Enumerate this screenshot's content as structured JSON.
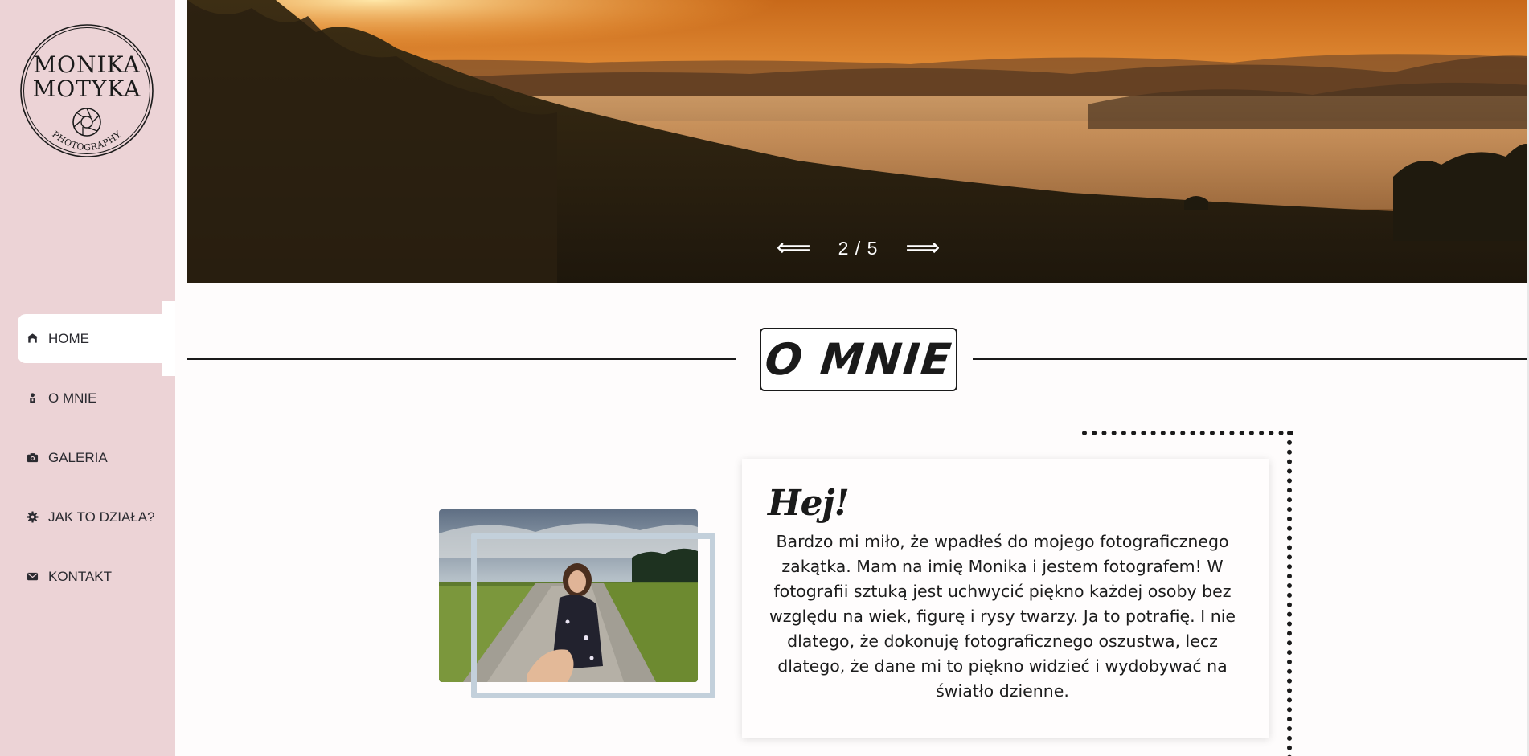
{
  "brand": {
    "line1": "MONIKA",
    "line2": "MOTYKA",
    "tagline": "PHOTOGRAPHY"
  },
  "nav": {
    "items": [
      {
        "label": "HOME",
        "icon": "home-icon",
        "active": true
      },
      {
        "label": "O MNIE",
        "icon": "person-icon",
        "active": false
      },
      {
        "label": "GALERIA",
        "icon": "camera-icon",
        "active": false
      },
      {
        "label": "JAK TO DZIAŁA?",
        "icon": "gear-icon",
        "active": false
      },
      {
        "label": "KONTAKT",
        "icon": "envelope-icon",
        "active": false
      }
    ]
  },
  "hero": {
    "prev_arrow": "⟸",
    "next_arrow": "⟹",
    "counter": "2 / 5",
    "current_slide": 2,
    "total_slides": 5
  },
  "about": {
    "section_title": "O MNIE",
    "greeting": "Hej!",
    "text": "Bardzo mi miło, że wpadłeś do mojego fotograficznego zakątka. Mam na imię Monika i jestem fotografem! W fotografii sztuką jest uchwycić piękno każdej osoby bez względu na wiek, figurę i rysy twarzy. Ja to potrafię. I nie dlatego, że dokonuję fotograficznego oszustwa, lecz dlatego, że dane mi to piękno widzieć i wydobywać na światło dzienne."
  },
  "colors": {
    "sidebar_bg": "#ecd3d6",
    "text_dark": "#1a1a1a",
    "photo_frame": "#c3d0db",
    "page_bg": "#fefcfc"
  }
}
